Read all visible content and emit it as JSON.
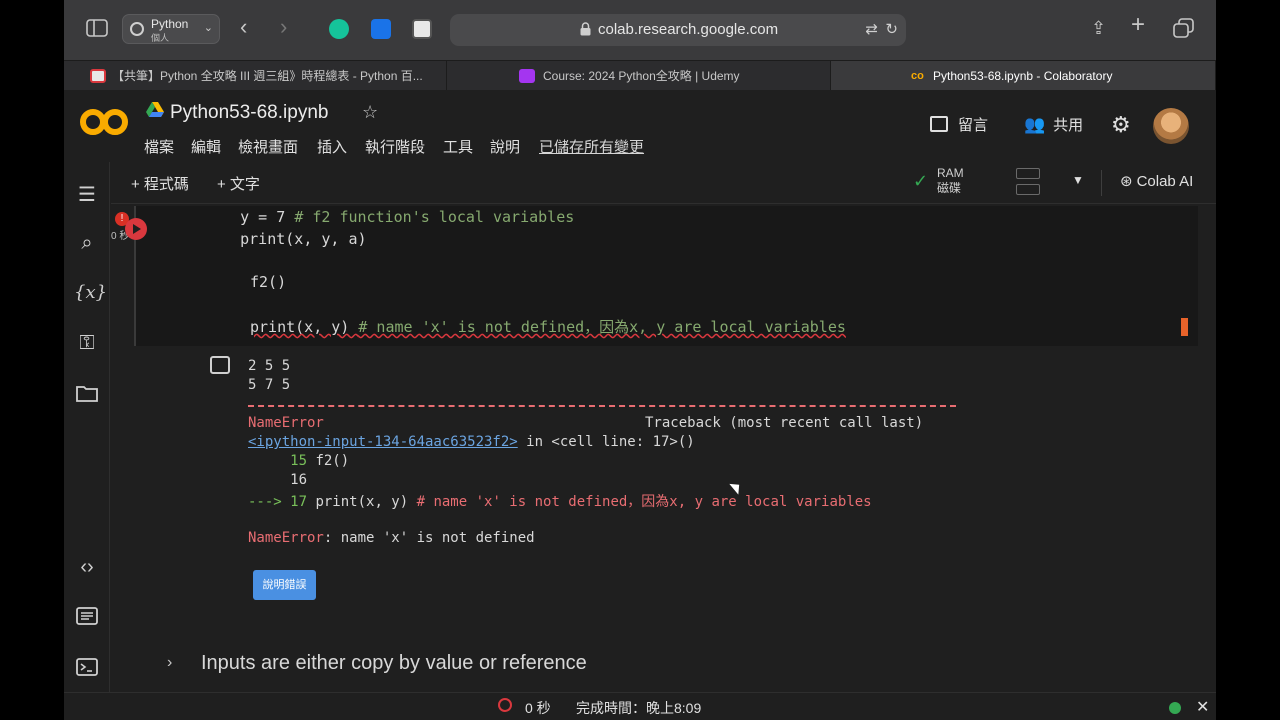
{
  "browser": {
    "profile_name": "Python",
    "profile_sub": "個人",
    "url": "colab.research.google.com"
  },
  "tabs": [
    {
      "label": "【共筆】Python 全攻略 III 週三組》時程總表 - Python 百..."
    },
    {
      "label": "Course: 2024 Python全攻略 | Udemy"
    },
    {
      "label": "Python53-68.ipynb - Colaboratory"
    }
  ],
  "header": {
    "notebook_title": "Python53-68.ipynb",
    "menu": [
      "檔案",
      "編輯",
      "檢視畫面",
      "插入",
      "執行階段",
      "工具",
      "說明"
    ],
    "saved_status": "已儲存所有變更",
    "comment_label": "留言",
    "share_label": "共用"
  },
  "toolbar": {
    "add_code": "+ 程式碼",
    "add_text": "+ 文字",
    "ram_label": "RAM",
    "disk_label": "磁碟",
    "colab_ai": "Colab AI"
  },
  "cell": {
    "exec_time": "0 秒",
    "line1_code": "    y = 7 ",
    "line1_comment": "# f2 function's local variables",
    "line2": "    print(x, y, a)",
    "line3": "f2()",
    "line4_code": "print(x, y) ",
    "line4_comment": "# name 'x' is not defined，因為x, y are local variables"
  },
  "output": {
    "line1": "2 5 5",
    "line2": "5 7 5",
    "err_name": "NameError",
    "traceback_label": "Traceback (most recent call last)",
    "input_link": "<ipython-input-134-64aac63523f2>",
    "in_cell": " in <cell line: 17>()",
    "tb15_num": "     15 ",
    "tb15_code": "f2()",
    "tb16_num": "     16",
    "tb17_arrow": "---> 17 ",
    "tb17_code": "print(x, y) ",
    "tb17_comment": "# name 'x' is not defined，因為x, y are local variables",
    "err_prefix": "NameError",
    "err_msg": ": name 'x' is not defined",
    "explain_button": "說明錯誤"
  },
  "next_section": "Inputs are either copy by value or reference",
  "status": {
    "time": "0 秒",
    "finished": "完成時間：晚上8:09"
  }
}
